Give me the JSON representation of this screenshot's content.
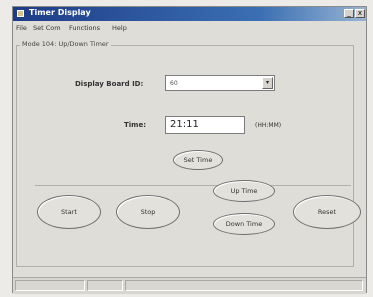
{
  "window": {
    "title": "Timer Display",
    "controls": {
      "minimize": "_",
      "close": "x"
    }
  },
  "menu": [
    "File",
    "Set Com",
    "Functions",
    "Help"
  ],
  "group": {
    "title": "Mode 104: Up/Down Timer"
  },
  "display_board": {
    "label": "Display Board ID:",
    "value": "60",
    "arrow": "▾"
  },
  "time": {
    "label": "Time:",
    "value": "21:11",
    "format": "(HH:MM)"
  },
  "buttons": {
    "set_time": "Set Time",
    "start": "Start",
    "stop": "Stop",
    "up_time": "Up Time",
    "down_time": "Down Time",
    "reset": "Reset"
  }
}
